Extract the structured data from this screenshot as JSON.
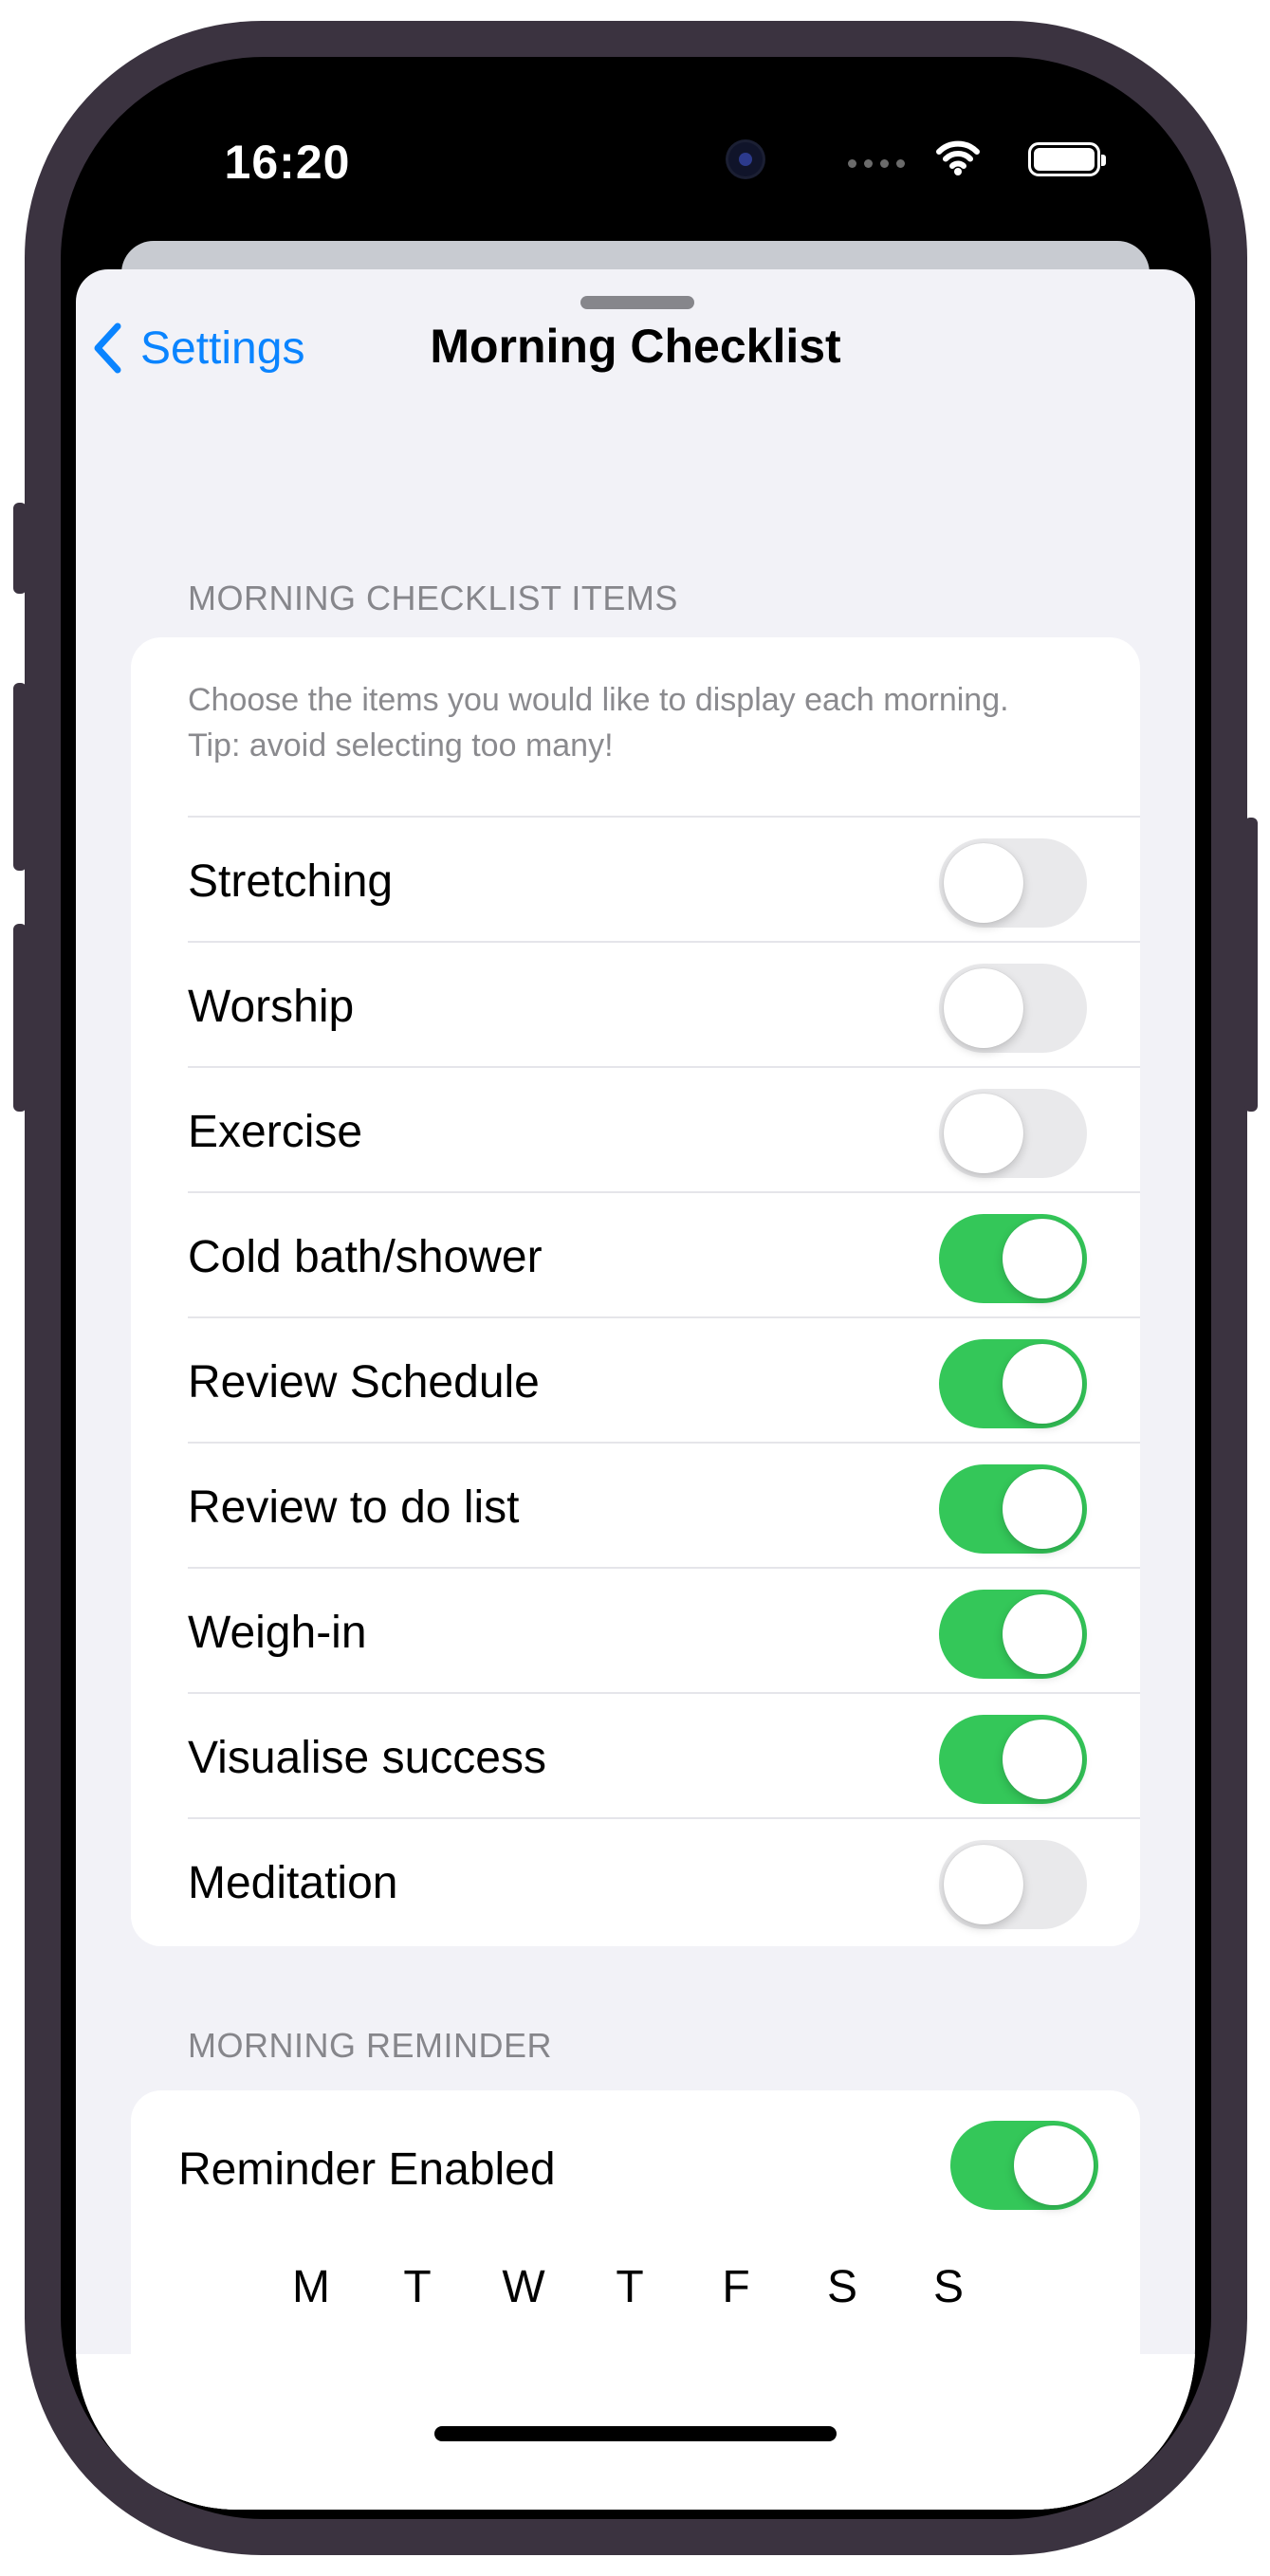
{
  "status_bar": {
    "time": "16:20"
  },
  "nav": {
    "back_label": "Settings",
    "title": "Morning Checklist"
  },
  "checklist": {
    "header": "MORNING CHECKLIST ITEMS",
    "description": "Choose the items you would like to display each morning. Tip: avoid selecting too many!",
    "items": [
      {
        "label": "Stretching",
        "enabled": false
      },
      {
        "label": "Worship",
        "enabled": false
      },
      {
        "label": "Exercise",
        "enabled": false
      },
      {
        "label": "Cold bath/shower",
        "enabled": true
      },
      {
        "label": "Review Schedule",
        "enabled": true
      },
      {
        "label": "Review to do list",
        "enabled": true
      },
      {
        "label": "Weigh-in",
        "enabled": true
      },
      {
        "label": "Visualise success",
        "enabled": true
      },
      {
        "label": "Meditation",
        "enabled": false
      }
    ]
  },
  "reminder": {
    "header": "MORNING REMINDER",
    "enabled_label": "Reminder Enabled",
    "enabled": true,
    "days": [
      {
        "letter": "M",
        "checked": true
      },
      {
        "letter": "T",
        "checked": true
      },
      {
        "letter": "W",
        "checked": true
      },
      {
        "letter": "T",
        "checked": true
      },
      {
        "letter": "F",
        "checked": true
      },
      {
        "letter": "S",
        "checked": true
      },
      {
        "letter": "S",
        "checked": false
      }
    ]
  },
  "colors": {
    "accent": "#0a84ff",
    "toggle_on": "#34c759",
    "toggle_off": "#e9e9eb",
    "unchecked_box": "#545456"
  }
}
